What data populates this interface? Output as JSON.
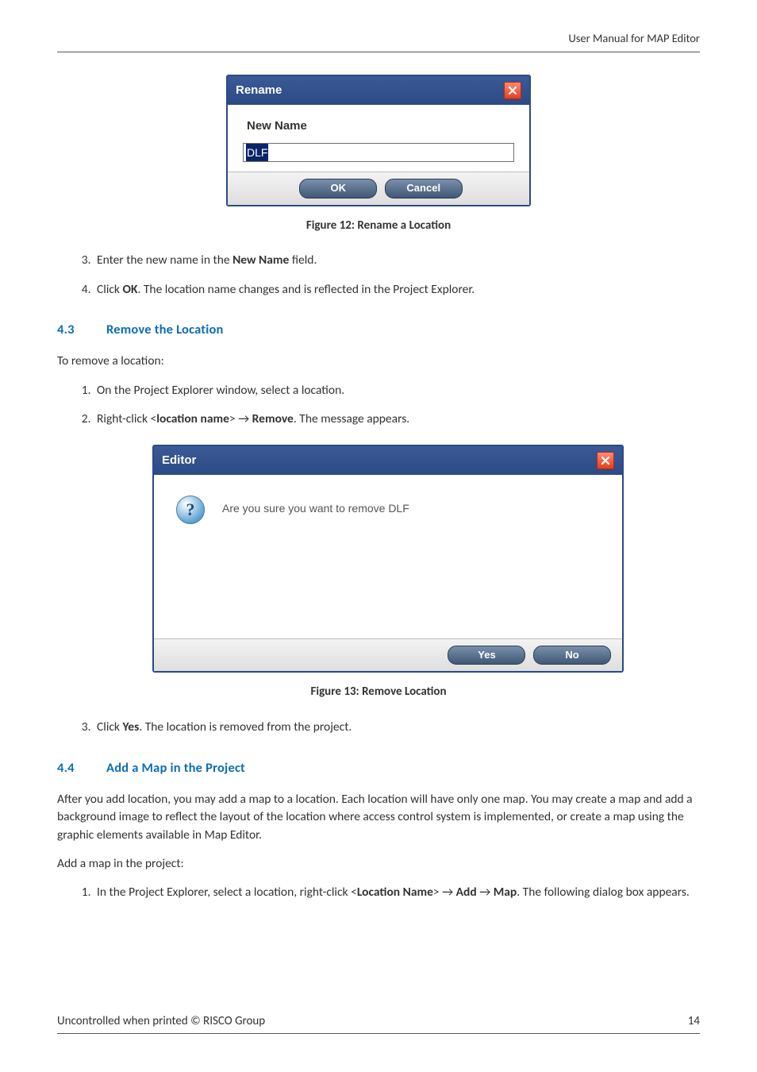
{
  "header": {
    "running_head": "User Manual for MAP Editor"
  },
  "dialog_rename": {
    "title": "Rename",
    "field_label": "New Name",
    "input_value": "DLF",
    "ok_label": "OK",
    "cancel_label": "Cancel"
  },
  "fig12": "Figure 12: Rename a Location",
  "list_a": {
    "start": 3,
    "items": [
      {
        "pre": "Enter the new name in the ",
        "b": "New Name",
        "post": " field."
      },
      {
        "pre": "Click ",
        "b": "OK",
        "post": ". The location name changes and is reflected in the Project Explorer."
      }
    ]
  },
  "sec43": {
    "num": "4.3",
    "title": "Remove the Location"
  },
  "para43_intro": "To remove a location:",
  "list_b": {
    "items": [
      {
        "text": "On the Project Explorer window, select a location."
      },
      {
        "pre": "Right-click <",
        "b1": "location name",
        "mid": "> → ",
        "b2": "Remove",
        "post": ". The message appears."
      }
    ]
  },
  "dialog_editor": {
    "title": "Editor",
    "message": "Are you sure you want to remove DLF",
    "yes_label": "Yes",
    "no_label": "No"
  },
  "fig13": "Figure 13: Remove Location",
  "list_c": {
    "start": 3,
    "items": [
      {
        "pre": "Click ",
        "b": "Yes",
        "post": ". The location is removed from the project."
      }
    ]
  },
  "sec44": {
    "num": "4.4",
    "title": "Add a Map in the Project"
  },
  "para44_body": "After you add location, you may add a map to a location. Each location will have only one map. You may create a map and add a background image to reflect the layout of the location where access control system is implemented, or create a map using the graphic elements available in Map Editor.",
  "para44_lead": "Add a map in the project:",
  "list_d": {
    "items": [
      {
        "pre": "In the Project Explorer, select a location, right-click <",
        "b1": "Location Name",
        "mid1": "> → ",
        "b2": "Add",
        "mid2": " → ",
        "b3": "Map",
        "post": ". The following dialog box appears."
      }
    ]
  },
  "footer": {
    "left": "Uncontrolled when printed © RISCO Group",
    "right": "14"
  }
}
